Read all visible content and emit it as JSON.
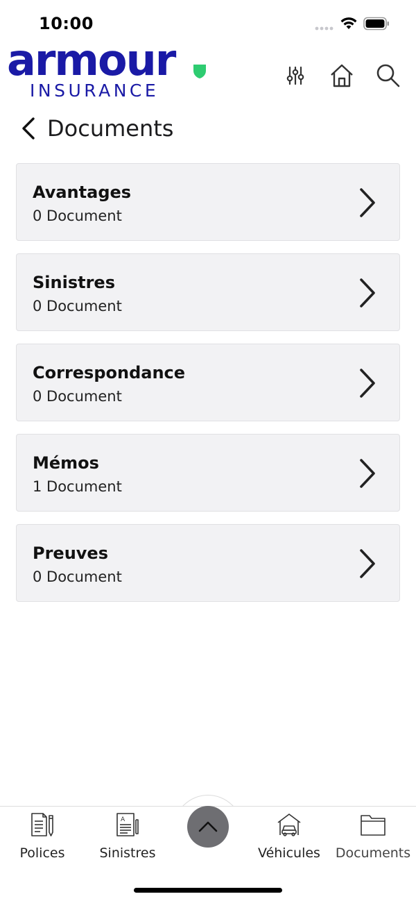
{
  "status_bar": {
    "time": "10:00"
  },
  "brand": {
    "name": "armour",
    "subtitle": "INSURANCE",
    "primary_color": "#1a1aa6",
    "accent_color": "#2ecc71"
  },
  "header": {
    "icons": [
      "filter-icon",
      "home-icon",
      "search-icon"
    ]
  },
  "page": {
    "title": "Documents"
  },
  "categories": [
    {
      "title": "Avantages",
      "count": "0 Document"
    },
    {
      "title": "Sinistres",
      "count": "0 Document"
    },
    {
      "title": "Correspondance",
      "count": "0 Document"
    },
    {
      "title": "Mémos",
      "count": "1 Document"
    },
    {
      "title": "Preuves",
      "count": "0 Document"
    }
  ],
  "tab_bar": {
    "tabs": [
      {
        "label": "Polices",
        "icon": "policy-document-icon"
      },
      {
        "label": "Sinistres",
        "icon": "claim-form-icon"
      },
      {
        "label": "Véhicules",
        "icon": "garage-car-icon"
      },
      {
        "label": "Documents",
        "icon": "folder-icon"
      }
    ],
    "active": "Documents",
    "center_button_icon": "chevron-up-icon"
  }
}
